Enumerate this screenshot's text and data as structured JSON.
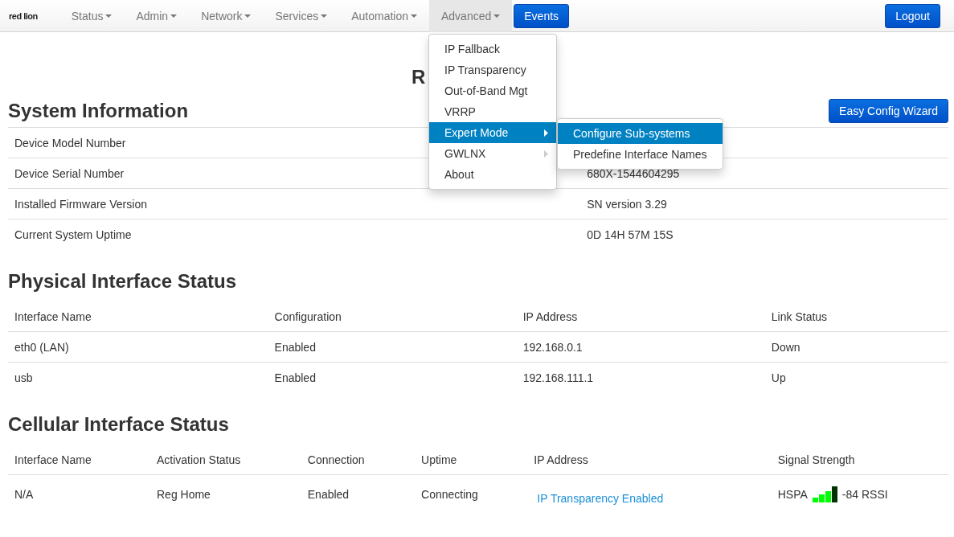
{
  "navbar": {
    "brand": "red lion",
    "menus": [
      {
        "label": "Status",
        "selected": false
      },
      {
        "label": "Admin",
        "selected": false
      },
      {
        "label": "Network",
        "selected": false
      },
      {
        "label": "Services",
        "selected": false
      },
      {
        "label": "Automation",
        "selected": false
      },
      {
        "label": "Advanced",
        "selected": true
      }
    ],
    "events_button": "Events",
    "logout_button": "Logout"
  },
  "dropdown": {
    "items": [
      {
        "label": "IP Fallback",
        "selected": false,
        "has_submenu": false
      },
      {
        "label": "IP Transparency",
        "selected": false,
        "has_submenu": false
      },
      {
        "label": "Out-of-Band Mgt",
        "selected": false,
        "has_submenu": false
      },
      {
        "label": "VRRP",
        "selected": false,
        "has_submenu": false
      },
      {
        "label": "Expert Mode",
        "selected": true,
        "has_submenu": true
      },
      {
        "label": "GWLNX",
        "selected": false,
        "has_submenu": true
      },
      {
        "label": "About",
        "selected": false,
        "has_submenu": false
      }
    ],
    "submenu": [
      {
        "label": "Configure Sub-systems",
        "selected": true
      },
      {
        "label": "Predefine Interface Names",
        "selected": false
      }
    ]
  },
  "page_title": "R",
  "system_information": {
    "title": "System Information",
    "wizard_button": "Easy Config Wizard",
    "rows": [
      {
        "label": "Device Model Number"
      },
      {
        "label": "Device Serial Number",
        "value": "680X-1544604295"
      },
      {
        "label": "Installed Firmware Version",
        "value": "SN version 3.29"
      },
      {
        "label": "Current System Uptime",
        "value": "0D 14H 57M 15S"
      }
    ]
  },
  "physical_interface_status": {
    "title": "Physical Interface Status",
    "columns": [
      "Interface Name",
      "Configuration",
      "IP Address",
      "Link Status"
    ],
    "rows": [
      [
        "eth0 (LAN)",
        "Enabled",
        "192.168.0.1",
        "Down"
      ],
      [
        "usb",
        "Enabled",
        "192.168.111.1",
        "Up"
      ]
    ]
  },
  "cellular_interface_status": {
    "title": "Cellular Interface Status",
    "columns": [
      "Interface Name",
      "Activation Status",
      "Connection",
      "Uptime",
      "IP Address",
      "Signal Strength"
    ],
    "rows": [
      {
        "interface_name": "N/A",
        "activation_status": "Reg Home",
        "connection": "Enabled",
        "uptime": "Connecting",
        "ip_address": "IP Transparency Enabled",
        "network_type": "HSPA",
        "signal_reading": "-84 RSSI"
      }
    ]
  }
}
